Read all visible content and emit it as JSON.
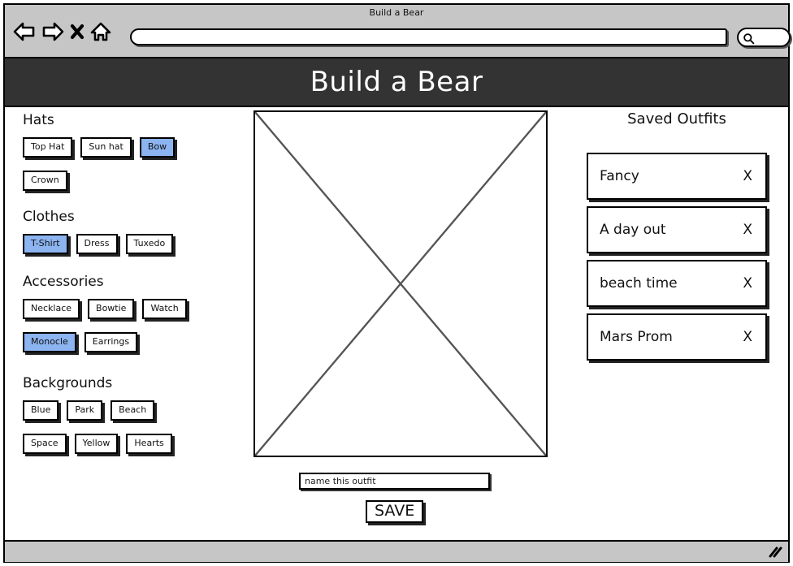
{
  "browser": {
    "window_title": "Build a Bear",
    "url_value": "",
    "url_placeholder": "",
    "search_value": "",
    "search_placeholder": "",
    "nav_icons": [
      {
        "name": "back-arrow-icon",
        "glyph": "back"
      },
      {
        "name": "forward-arrow-icon",
        "glyph": "forward"
      },
      {
        "name": "stop-icon",
        "glyph": "x"
      },
      {
        "name": "home-icon",
        "glyph": "home"
      }
    ],
    "search_icon": "search-icon",
    "resize_grip_icon": "resize-grip-icon"
  },
  "app": {
    "title": "Build a Bear",
    "header_bg": "#333333",
    "header_text_color": "#ffffff",
    "selected_chip_color": "#8cb4f0",
    "chrome_bg": "#c6c6c6"
  },
  "sections": [
    {
      "title": "Hats",
      "options": [
        {
          "label": "Top Hat",
          "selected": false
        },
        {
          "label": "Sun hat",
          "selected": false
        },
        {
          "label": "Bow",
          "selected": true
        },
        {
          "label": "Crown",
          "selected": false
        }
      ]
    },
    {
      "title": "Clothes",
      "options": [
        {
          "label": "T-Shirt",
          "selected": true
        },
        {
          "label": "Dress",
          "selected": false
        },
        {
          "label": "Tuxedo",
          "selected": false
        }
      ]
    },
    {
      "title": "Accessories",
      "options": [
        {
          "label": "Necklace",
          "selected": false
        },
        {
          "label": "Bowtie",
          "selected": false
        },
        {
          "label": "Watch",
          "selected": false
        },
        {
          "label": "Monocle",
          "selected": true
        },
        {
          "label": "Earrings",
          "selected": false
        }
      ]
    },
    {
      "title": "Backgrounds",
      "options": [
        {
          "label": "Blue",
          "selected": false
        },
        {
          "label": "Park",
          "selected": false
        },
        {
          "label": "Beach",
          "selected": false
        },
        {
          "label": "Space",
          "selected": false
        },
        {
          "label": "Yellow",
          "selected": false
        },
        {
          "label": "Hearts",
          "selected": false
        }
      ]
    }
  ],
  "preview": {
    "placeholder_icon": "image-placeholder-icon"
  },
  "outfit_form": {
    "name_value": "",
    "name_placeholder": "name this outfit",
    "save_label": "SAVE"
  },
  "saved": {
    "title": "Saved Outfits",
    "delete_label": "X",
    "items": [
      {
        "name": "Fancy"
      },
      {
        "name": "A day out"
      },
      {
        "name": "beach time"
      },
      {
        "name": "Mars Prom"
      }
    ]
  }
}
